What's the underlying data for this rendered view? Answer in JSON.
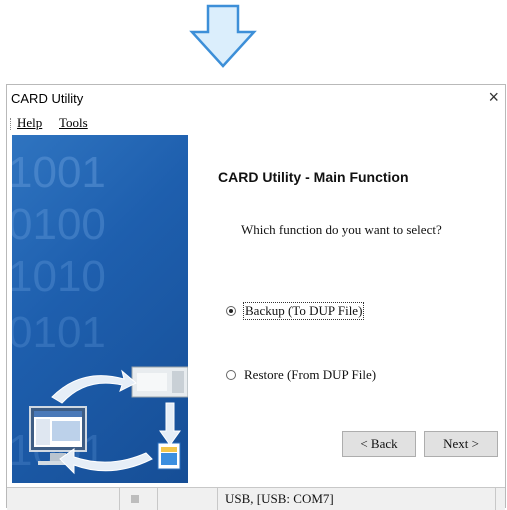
{
  "window": {
    "title": "CARD Utility",
    "close_glyph": "×"
  },
  "menu": {
    "help": "Help",
    "tools": "Tools"
  },
  "banner": {
    "digits": [
      "1001",
      "0100",
      "1010",
      "0101",
      "1001"
    ]
  },
  "main": {
    "heading": "CARD Utility - Main Function",
    "question": "Which function do you want to select?",
    "options": [
      {
        "label": "Backup (To DUP File)",
        "selected": true
      },
      {
        "label": "Restore (From DUP File)",
        "selected": false
      }
    ],
    "back_label": "< Back",
    "next_label": "Next >"
  },
  "status": {
    "connection": "USB, [USB: COM7]"
  },
  "colors": {
    "banner_blue": "#1e5fae",
    "arrow_blue": "#5aa8e8"
  },
  "icons": {
    "arrow": "down-arrow-icon",
    "close": "close-icon"
  }
}
